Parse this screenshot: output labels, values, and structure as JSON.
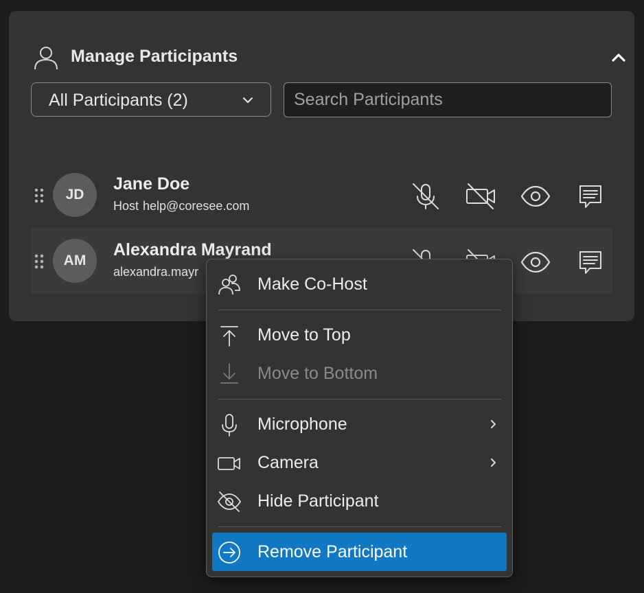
{
  "panel": {
    "title": "Manage Participants",
    "filter": {
      "selected": "All Participants (2)"
    },
    "search": {
      "placeholder": "Search Participants",
      "value": ""
    }
  },
  "participants": [
    {
      "initials": "JD",
      "name": "Jane Doe",
      "role": "Host",
      "email": "help@coresee.com"
    },
    {
      "initials": "AM",
      "name": "Alexandra Mayrand",
      "role": "",
      "email": "alexandra.mayr"
    }
  ],
  "context_menu": {
    "items": [
      {
        "label": "Make Co-Host",
        "icon": "co-host-icon"
      },
      {
        "label": "Move to Top",
        "icon": "move-to-top-icon"
      },
      {
        "label": "Move to Bottom",
        "icon": "move-to-bottom-icon",
        "disabled": true
      },
      {
        "label": "Microphone",
        "icon": "microphone-icon",
        "submenu": true
      },
      {
        "label": "Camera",
        "icon": "camera-icon",
        "submenu": true
      },
      {
        "label": "Hide Participant",
        "icon": "eye-off-icon"
      },
      {
        "label": "Remove Participant",
        "icon": "remove-icon",
        "highlighted": true
      }
    ]
  },
  "colors": {
    "background": "#1c1c1c",
    "panel": "#333333",
    "highlight": "#1178c4",
    "text": "#e6e6e6",
    "disabled_text": "#8a8a8a"
  }
}
